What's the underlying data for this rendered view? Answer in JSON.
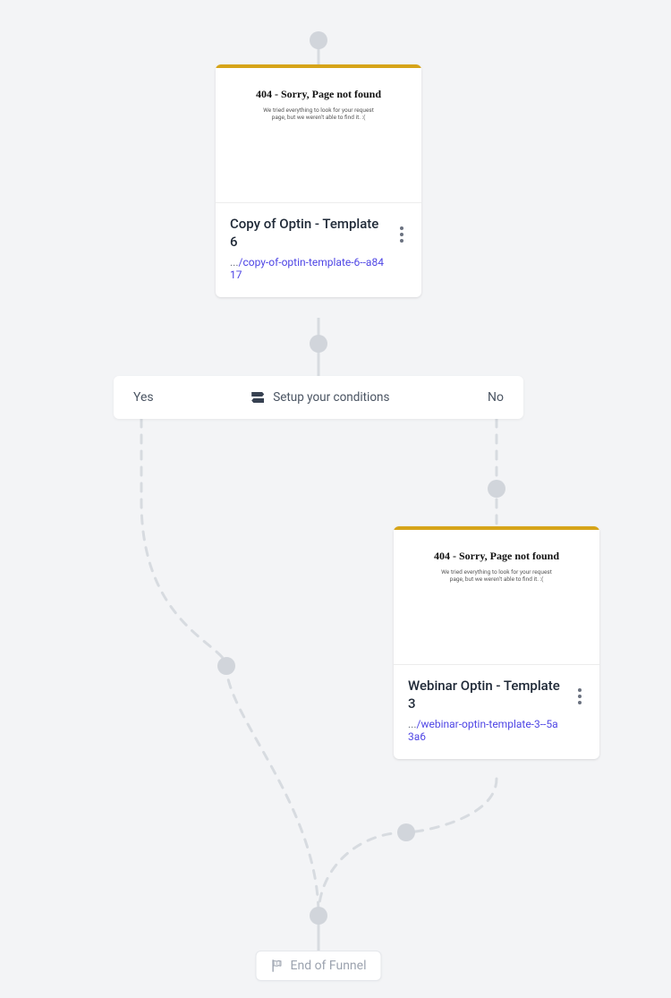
{
  "flow": {
    "card1": {
      "preview_title": "404 - Sorry, Page not found",
      "preview_sub": "We tried everything to look for your request page, but we weren't able to find it. :(",
      "title": "Copy of Optin - Template 6",
      "url_prefix": "...",
      "url_path": "/copy-of-optin-template-6--a8417"
    },
    "condition": {
      "yes_label": "Yes",
      "no_label": "No",
      "setup_label": "Setup your conditions"
    },
    "card2": {
      "preview_title": "404 - Sorry, Page not found",
      "preview_sub": "We tried everything to look for your request page, but we weren't able to find it. :(",
      "title": "Webinar Optin - Template 3",
      "url_prefix": "...",
      "url_path": "/webinar-optin-template-3--5a3a6"
    },
    "end_label": "End of Funnel"
  }
}
